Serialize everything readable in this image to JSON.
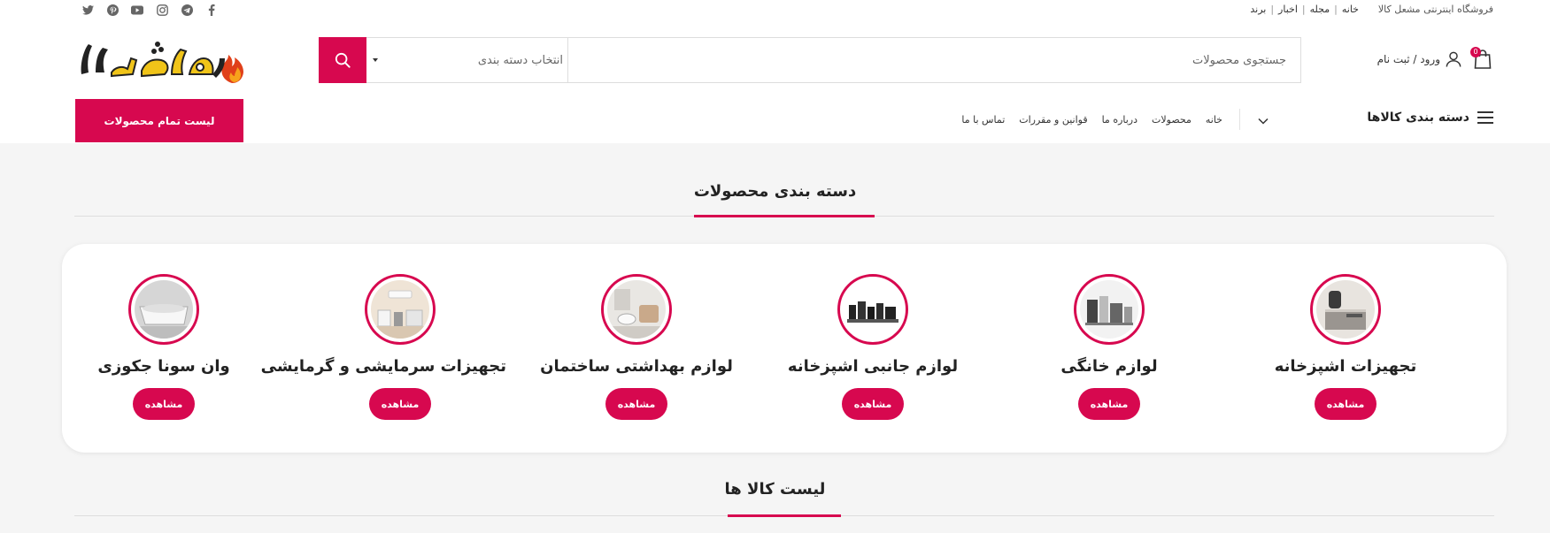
{
  "topbar": {
    "shop_name": "فروشگاه اینترنتی مشعل کالا",
    "links": [
      "خانه",
      "مجله",
      "اخبار",
      "برند"
    ],
    "social_icons": [
      "facebook-icon",
      "telegram-icon",
      "instagram-icon",
      "youtube-icon",
      "pinterest-icon",
      "twitter-icon"
    ]
  },
  "header": {
    "cart_count": "0",
    "login_label": "ورود / ثبت نام",
    "search_placeholder": "جستجوی محصولات",
    "category_select": "انتخاب دسته بندی",
    "logo_text": "مشعل کالا",
    "accent_color": "#d7084f"
  },
  "navbar": {
    "categories_label": "دسته بندی کالاها",
    "links": [
      "خانه",
      "محصولات",
      "درباره ما",
      "قوانین و مقررات",
      "تماس با ما"
    ],
    "all_products_button": "لیست تمام محصولات"
  },
  "categories_section": {
    "title": "دسته بندی محصولات",
    "view_label": "مشاهده",
    "items": [
      {
        "name": "تجهیزات اشپزخانه",
        "icon": "kitchen-equipment-image"
      },
      {
        "name": "لوازم خانگی",
        "icon": "home-appliances-image"
      },
      {
        "name": "لوازم جانبی اشپزخانه",
        "icon": "kitchen-accessories-image"
      },
      {
        "name": "لوازم بهداشتی ساختمان",
        "icon": "sanitary-ware-image"
      },
      {
        "name": "تجهیزات سرمایشی و گرمایشی",
        "icon": "heating-cooling-image"
      },
      {
        "name": "وان سونا جکوزی",
        "icon": "bathtub-jacuzzi-image"
      }
    ]
  },
  "products_section": {
    "title": "لیست کالا ها"
  }
}
